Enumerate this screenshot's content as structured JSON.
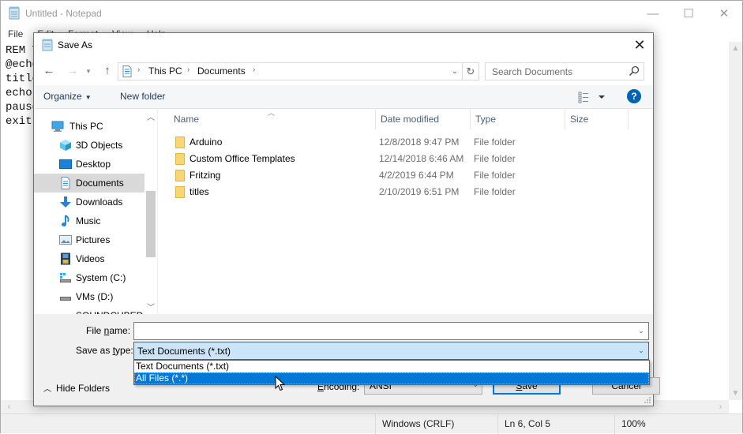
{
  "notepad": {
    "title": "Untitled - Notepad",
    "menu": [
      "File",
      "Edit",
      "Format",
      "View",
      "Help"
    ],
    "editor_lines": [
      "REM T",
      "@echo",
      "title",
      "echo ",
      "pause",
      "exit "
    ],
    "status": {
      "line_ending": "Windows (CRLF)",
      "position": "Ln 6, Col 5",
      "zoom": "100%"
    }
  },
  "dialog": {
    "title": "Save As",
    "close_label": "✕",
    "address": {
      "crumbs": [
        "This PC",
        "Documents"
      ]
    },
    "search": {
      "placeholder": "Search Documents"
    },
    "toolbar": {
      "organize_label": "Organize",
      "new_folder_label": "New folder",
      "help_label": "?"
    },
    "nav_items": [
      {
        "label": "This PC",
        "icon": "computer-icon",
        "level": 0,
        "selected": false
      },
      {
        "label": "3D Objects",
        "icon": "cube-icon",
        "level": 1,
        "selected": false
      },
      {
        "label": "Desktop",
        "icon": "desktop-icon",
        "level": 1,
        "selected": false
      },
      {
        "label": "Documents",
        "icon": "document-icon",
        "level": 1,
        "selected": true
      },
      {
        "label": "Downloads",
        "icon": "download-arrow-icon",
        "level": 1,
        "selected": false
      },
      {
        "label": "Music",
        "icon": "music-note-icon",
        "level": 1,
        "selected": false
      },
      {
        "label": "Pictures",
        "icon": "picture-icon",
        "level": 1,
        "selected": false
      },
      {
        "label": "Videos",
        "icon": "film-icon",
        "level": 1,
        "selected": false
      },
      {
        "label": "System (C:)",
        "icon": "system-drive-icon",
        "level": 1,
        "selected": false
      },
      {
        "label": "VMs (D:)",
        "icon": "drive-icon",
        "level": 1,
        "selected": false
      },
      {
        "label": "SOUNDCUBED (I",
        "icon": "drive-icon",
        "level": 1,
        "selected": false
      }
    ],
    "columns": [
      "Name",
      "Date modified",
      "Type",
      "Size"
    ],
    "files": [
      {
        "name": "Arduino",
        "date": "12/8/2018 9:47 PM",
        "type": "File folder",
        "size": ""
      },
      {
        "name": "Custom Office Templates",
        "date": "12/14/2018 6:46 AM",
        "type": "File folder",
        "size": ""
      },
      {
        "name": "Fritzing",
        "date": "4/2/2019 6:44 PM",
        "type": "File folder",
        "size": ""
      },
      {
        "name": "titles",
        "date": "2/10/2019 6:51 PM",
        "type": "File folder",
        "size": ""
      }
    ],
    "form": {
      "file_name_label_pre": "File ",
      "file_name_label_u": "n",
      "file_name_label_post": "ame:",
      "file_name_value": "",
      "save_type_label_pre": "Save as ",
      "save_type_label_u": "t",
      "save_type_label_post": "ype:",
      "save_type_value": "Text Documents (*.txt)",
      "save_type_options": [
        "Text Documents (*.txt)",
        "All Files  (*.*)"
      ],
      "save_type_highlighted": 1,
      "encoding_label_u": "E",
      "encoding_label_post": "ncoding:",
      "encoding_value": "ANSI",
      "save_label_u": "S",
      "save_label_post": "ave",
      "cancel_label": "Cancel",
      "hide_folders_label": "Hide Folders"
    }
  }
}
